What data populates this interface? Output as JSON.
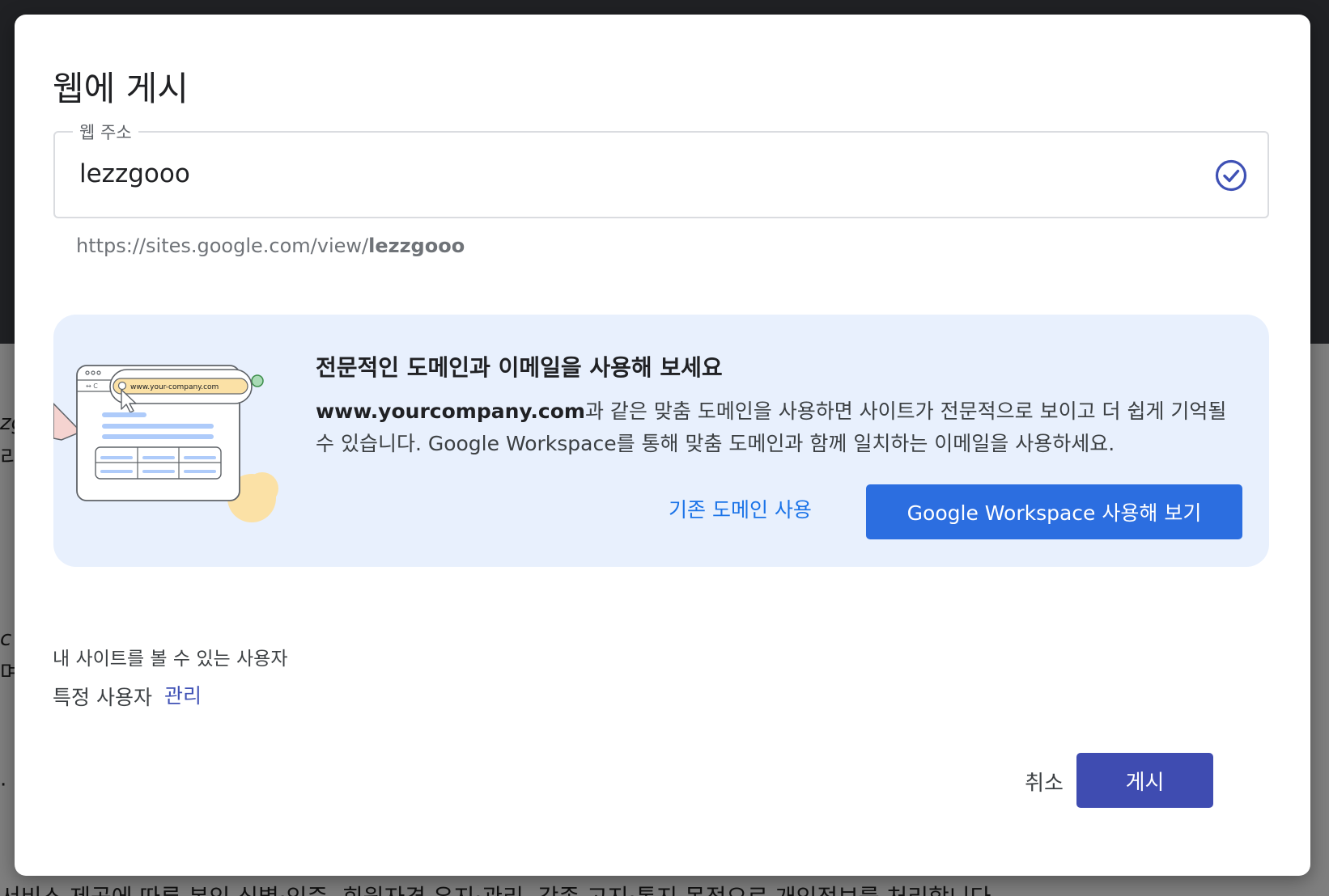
{
  "background": {
    "fragments": [
      "zg",
      "리",
      "c",
      "며",
      "· C"
    ],
    "footer_text": "서비스 제공에 따른 본인 식별·인증, 회원자격 유지·관리, 각종 고지·통지 목적으로 개인정보를 처리합니다."
  },
  "dialog": {
    "title": "웹에 게시",
    "url_field": {
      "label": "웹 주소",
      "value": "lezzgooo",
      "status_icon": "check-circle-icon"
    },
    "url_preview": {
      "prefix": "https://sites.google.com/view/",
      "slug": "lezzgooo"
    },
    "promo": {
      "illustration_url_text": "www.your-company.com",
      "heading": "전문적인 도메인과 이메일을 사용해 보세요",
      "body_bold": "www.yourcompany.com",
      "body_rest": "과 같은 맞춤 도메인을 사용하면 사이트가 전문적으로 보이고 더 쉽게 기억될 수 있습니다. Google Workspace를 통해 맞춤 도메인과 함께 일치하는 이메일을 사용하세요.",
      "link_label": "기존 도메인 사용",
      "primary_label": "Google Workspace 사용해 보기"
    },
    "visibility": {
      "label": "내 사이트를 볼 수 있는 사용자",
      "value": "특정 사용자",
      "manage_label": "관리"
    },
    "actions": {
      "cancel_label": "취소",
      "publish_label": "게시"
    }
  },
  "colors": {
    "accent_blue": "#2c6ee0",
    "publish_indigo": "#3f4cb1",
    "link_blue": "#1a73e8",
    "promo_bg": "#e8f0fd"
  }
}
